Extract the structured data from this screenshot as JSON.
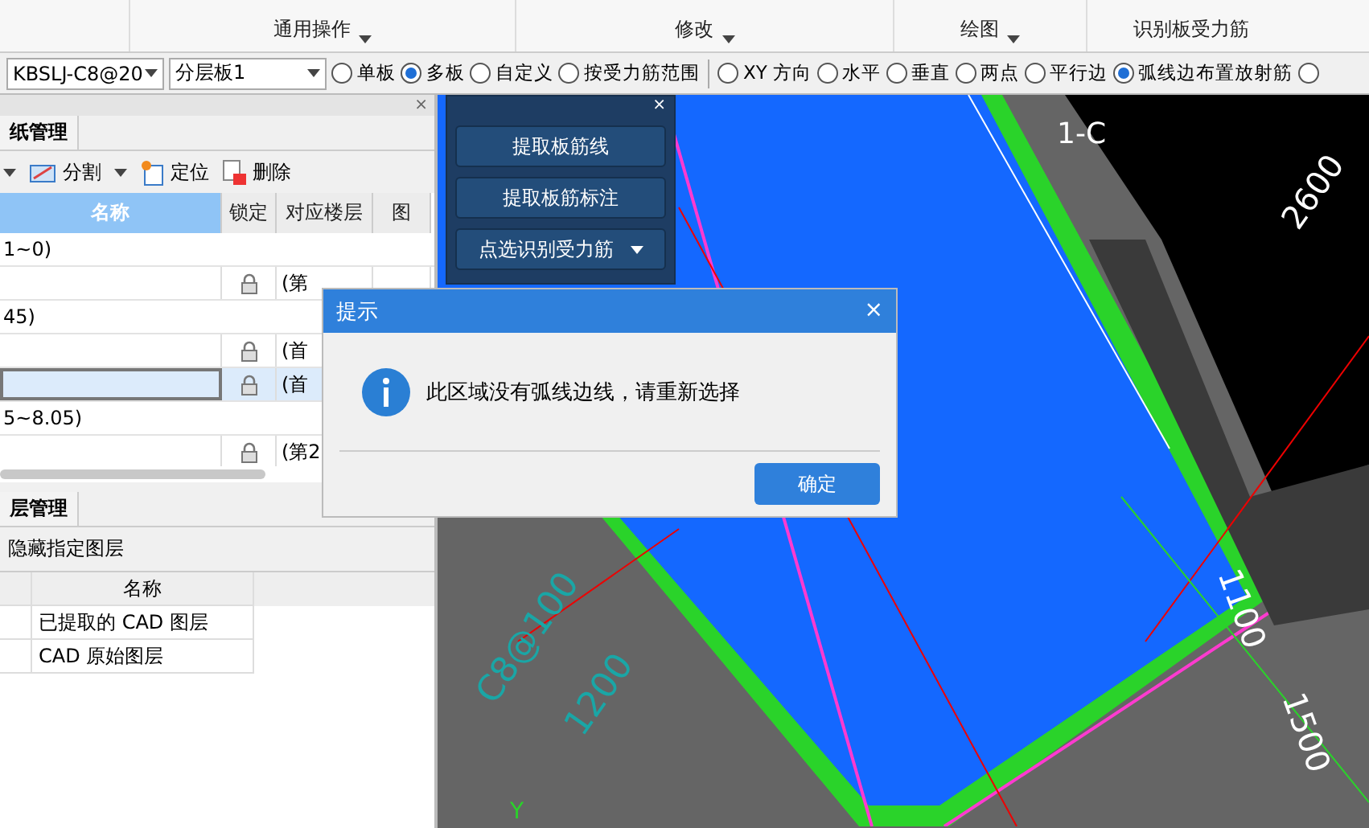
{
  "ribbon": {
    "groups": [
      {
        "label": "通用操作",
        "dropdown": true
      },
      {
        "label": "修改",
        "dropdown": true
      },
      {
        "label": "绘图",
        "dropdown": true
      },
      {
        "label": "识别板受力筋",
        "dropdown": false
      }
    ]
  },
  "options_bar": {
    "combos": [
      {
        "value": "KBSLJ-C8@20"
      },
      {
        "value": "分层板1"
      }
    ],
    "radio_groups": [
      [
        {
          "label": "单板",
          "selected": false
        },
        {
          "label": "多板",
          "selected": true
        },
        {
          "label": "自定义",
          "selected": false
        },
        {
          "label": "按受力筋范围",
          "selected": false
        }
      ],
      [
        {
          "label": "XY 方向",
          "selected": false
        },
        {
          "label": "水平",
          "selected": false
        },
        {
          "label": "垂直",
          "selected": false
        },
        {
          "label": "两点",
          "selected": false
        },
        {
          "label": "平行边",
          "selected": false
        },
        {
          "label": "弧线边布置放射筋",
          "selected": true
        },
        {
          "selected": false
        }
      ]
    ]
  },
  "drawing_panel": {
    "tab": "纸管理",
    "close": "×",
    "toolbar": [
      {
        "label": "分割",
        "kind": "split"
      },
      {
        "label": "定位",
        "kind": "locate"
      },
      {
        "label": "删除",
        "kind": "delete"
      }
    ],
    "columns": [
      "名称",
      "锁定",
      "对应楼层",
      "图"
    ],
    "rows": [
      {
        "kind": "group",
        "name": "1~0)"
      },
      {
        "kind": "item",
        "name": "",
        "locked": true,
        "floor": "(第",
        "selected": false
      },
      {
        "kind": "group",
        "name": "45)"
      },
      {
        "kind": "item",
        "name": "",
        "locked": true,
        "floor": "(首",
        "selected": false
      },
      {
        "kind": "item",
        "name": "",
        "locked": true,
        "floor": "(首",
        "selected": true
      },
      {
        "kind": "group",
        "name": "5~8.05)"
      },
      {
        "kind": "item",
        "name": "",
        "locked": true,
        "floor": "(第2",
        "selected": false
      }
    ]
  },
  "layer_panel": {
    "tab": "层管理",
    "toolbar": "隐藏指定图层",
    "column": "名称",
    "rows": [
      "已提取的 CAD 图层",
      "CAD 原始图层"
    ]
  },
  "float_panel": {
    "close": "×",
    "buttons": [
      {
        "label": "提取板筋线",
        "dropdown": false
      },
      {
        "label": "提取板筋标注",
        "dropdown": false
      },
      {
        "label": "点选识别受力筋",
        "dropdown": true
      }
    ]
  },
  "canvas": {
    "labels": [
      {
        "text": "1-C",
        "kind": "axis"
      },
      {
        "text": "2600",
        "kind": "dim"
      },
      {
        "text": "1100",
        "kind": "dim"
      },
      {
        "text": "1500",
        "kind": "dim"
      },
      {
        "text": "C8@100",
        "kind": "rebar"
      },
      {
        "text": "1200",
        "kind": "rebar"
      },
      {
        "text": "Y",
        "kind": "ucs"
      }
    ]
  },
  "dialog": {
    "title": "提示",
    "close": "×",
    "message": "此区域没有弧线边线，请重新选择",
    "button": "确定"
  }
}
